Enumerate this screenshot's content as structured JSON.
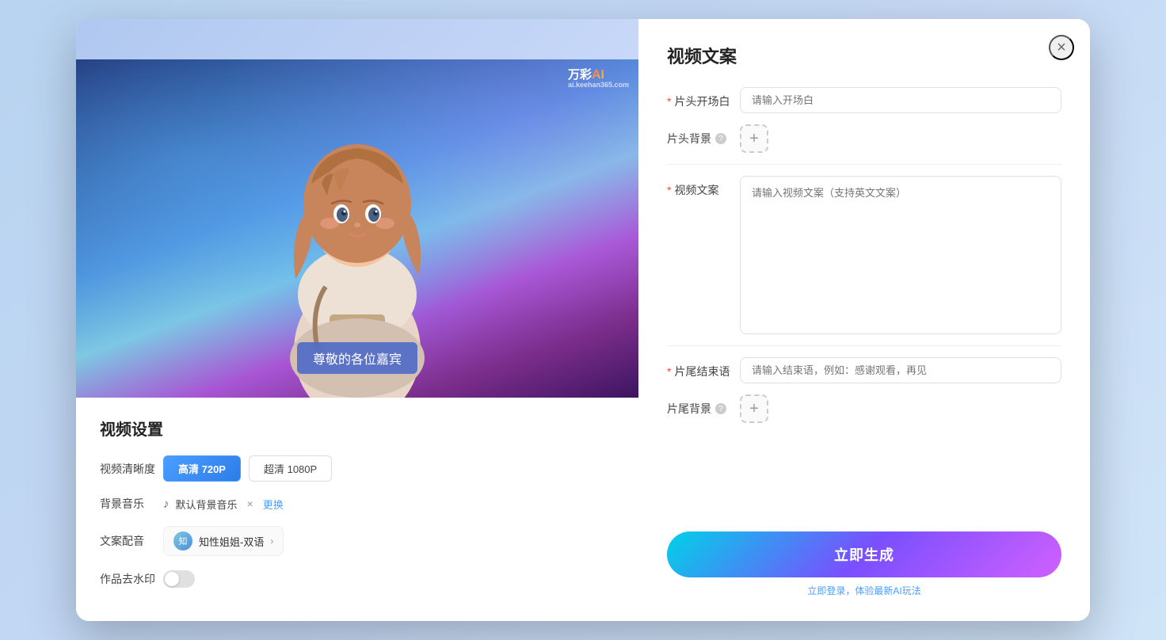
{
  "modal": {
    "close_label": "×"
  },
  "left": {
    "watermark_brand": "万彩",
    "watermark_ai": "AI",
    "watermark_url": "ai.keehan365.com",
    "subtitle_text": "尊敬的各位嘉宾",
    "settings_title": "视频设置",
    "resolution_label": "视频清晰度",
    "resolution_options": [
      {
        "label": "高清 720P",
        "active": true
      },
      {
        "label": "超清 1080P",
        "active": false
      }
    ],
    "music_label": "背景音乐",
    "music_note_icon": "♪",
    "music_default": "默认背景音乐",
    "music_remove": "×",
    "music_change": "更换",
    "voice_label": "文案配音",
    "voice_name": "知性姐姐-双语",
    "voice_arrow": "›",
    "watermark_label": "作品去水印"
  },
  "right": {
    "title": "视频文案",
    "opening_label": "片头开场白",
    "opening_required": "*",
    "opening_placeholder": "请输入开场白",
    "bg_label": "片头背景",
    "bg_help": "?",
    "bg_add": "+",
    "video_copy_label": "视频文案",
    "video_copy_required": "*",
    "video_copy_placeholder": "请输入视频文案（支持英文文案）",
    "ending_label": "片尾结束语",
    "ending_required": "*",
    "ending_placeholder": "请输入结束语，例如：感谢观看，再见",
    "ending_bg_label": "片尾背景",
    "ending_bg_help": "?",
    "ending_bg_add": "+",
    "generate_btn_label": "立即生成",
    "login_hint_prefix": "立即登录，体验最新AI玩法",
    "login_link": "立即登录"
  }
}
